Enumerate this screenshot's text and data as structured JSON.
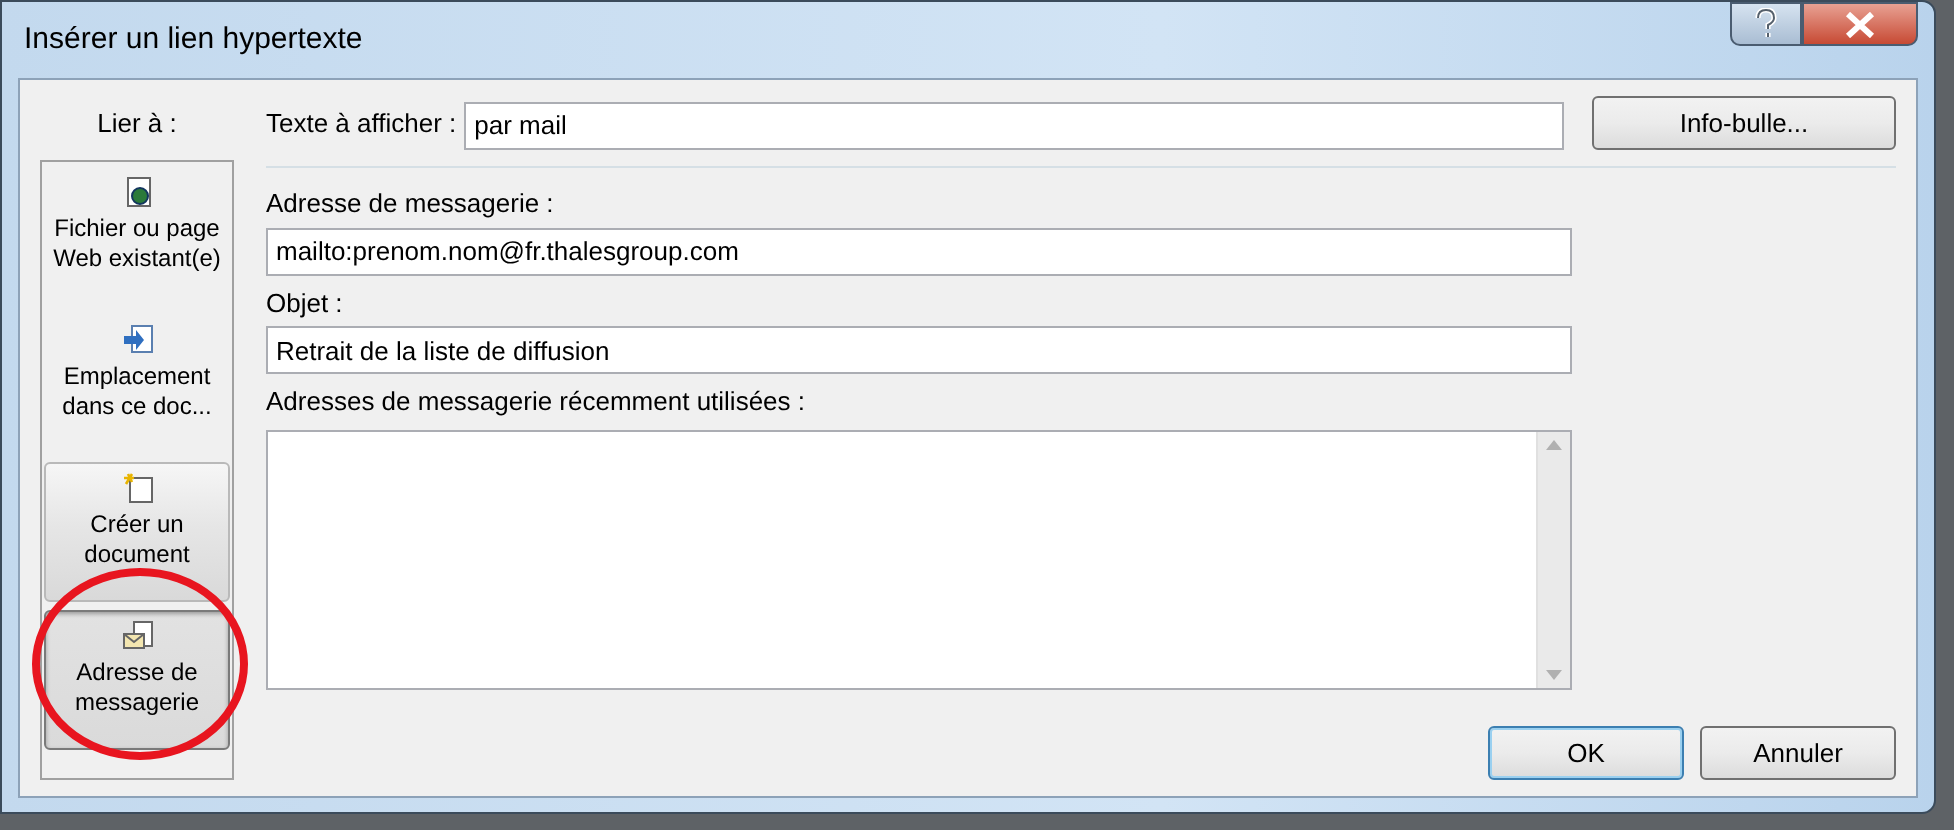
{
  "window": {
    "title": "Insérer un lien hypertexte"
  },
  "link_to": {
    "label": "Lier à :",
    "items": [
      {
        "label": "Fichier ou page Web existant(e)",
        "kind": "web",
        "selected": false,
        "raised": false
      },
      {
        "label": "Emplacement dans ce doc...",
        "kind": "place",
        "selected": false,
        "raised": false
      },
      {
        "label": "Créer un document",
        "kind": "new",
        "selected": false,
        "raised": true
      },
      {
        "label": "Adresse de messagerie",
        "kind": "mail",
        "selected": true,
        "raised": true
      }
    ]
  },
  "display_text": {
    "label": "Texte à afficher :",
    "value": "par mail"
  },
  "tooltip_button": "Info-bulle...",
  "email": {
    "label": "Adresse de messagerie :",
    "value": "mailto:prenom.nom@fr.thalesgroup.com"
  },
  "subject": {
    "label": "Objet :",
    "value": "Retrait de la liste de diffusion"
  },
  "recent": {
    "label": "Adresses de messagerie récemment utilisées :"
  },
  "buttons": [
    {
      "label": "OK",
      "default": true
    },
    {
      "label": "Annuler",
      "default": false
    }
  ]
}
